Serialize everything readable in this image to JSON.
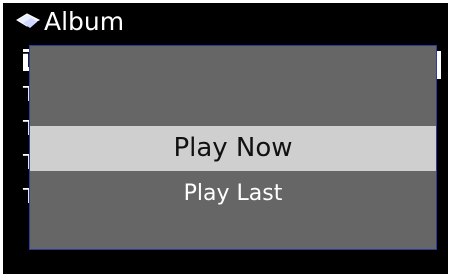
{
  "header": {
    "icon": "music-note-icon",
    "title": "Album"
  },
  "list": {
    "items": [
      "T",
      "T",
      "T",
      "T",
      "T"
    ]
  },
  "popup": {
    "options": [
      {
        "label": "Play Now",
        "state": "highlighted"
      },
      {
        "label": "Play Last",
        "state": "normal"
      }
    ]
  },
  "colors": {
    "screen_background": "#000000",
    "popup_background": "#666666",
    "popup_border": "#2d3a9e",
    "highlight": "#cfcfcf"
  }
}
